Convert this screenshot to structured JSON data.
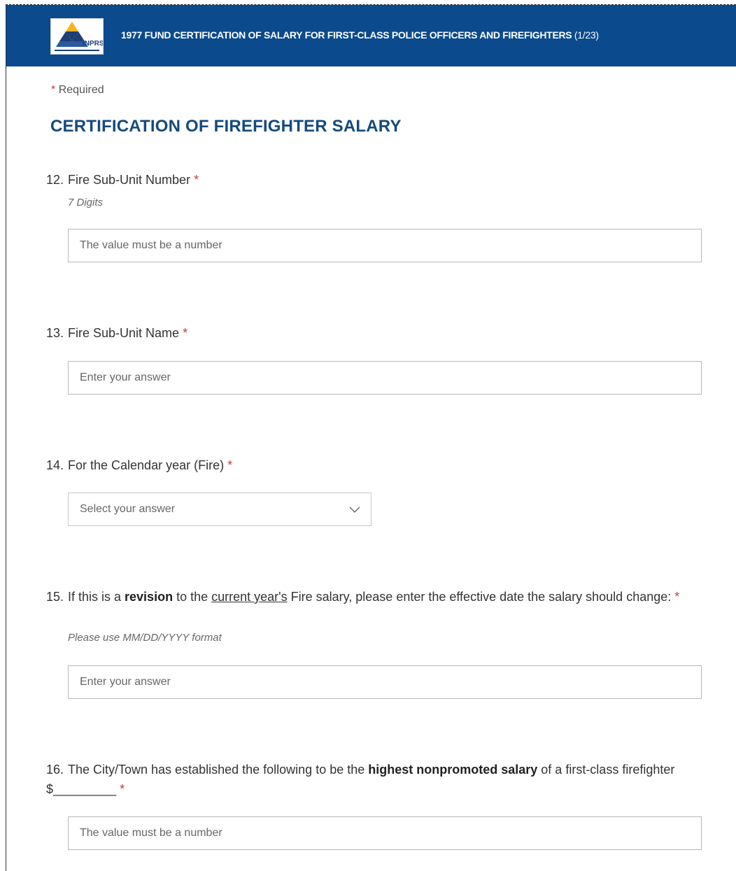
{
  "header": {
    "title": "1977 FUND CERTIFICATION OF SALARY FOR FIRST-CLASS POLICE OFFICERS AND FIREFIGHTERS",
    "page_indicator": "(1/23)",
    "logo_text": "INPRS"
  },
  "required_note": {
    "star": "*",
    "text": "Required"
  },
  "section_title": "CERTIFICATION OF FIREFIGHTER SALARY",
  "questions": [
    {
      "number": "12.",
      "label": "Fire Sub-Unit Number",
      "required": "*",
      "hint": "7 Digits",
      "placeholder": "The value must be a number"
    },
    {
      "number": "13.",
      "label": "Fire Sub-Unit Name",
      "required": "*",
      "placeholder": "Enter your answer"
    },
    {
      "number": "14.",
      "label": "For the Calendar year (Fire)",
      "required": "*",
      "select_placeholder": "Select your answer",
      "icon": "chevron-down-icon"
    },
    {
      "number": "15.",
      "text_parts": [
        "If this is a ",
        "revision",
        " to the ",
        "current year's",
        " Fire salary, please enter the effective date the salary should change: "
      ],
      "required": "*",
      "hint": "Please use MM/DD/YYYY format",
      "placeholder": "Enter your answer"
    },
    {
      "number": "16.",
      "text_parts": [
        "The City/Town has established the following to be the ",
        "highest nonpromoted salary",
        " of a first-class firefighter $_________ "
      ],
      "required": "*",
      "placeholder": "The value must be a number"
    }
  ],
  "colors": {
    "header_bg": "#0b4a8c",
    "section_title": "#154a7d",
    "required_star": "#c43e3e"
  }
}
